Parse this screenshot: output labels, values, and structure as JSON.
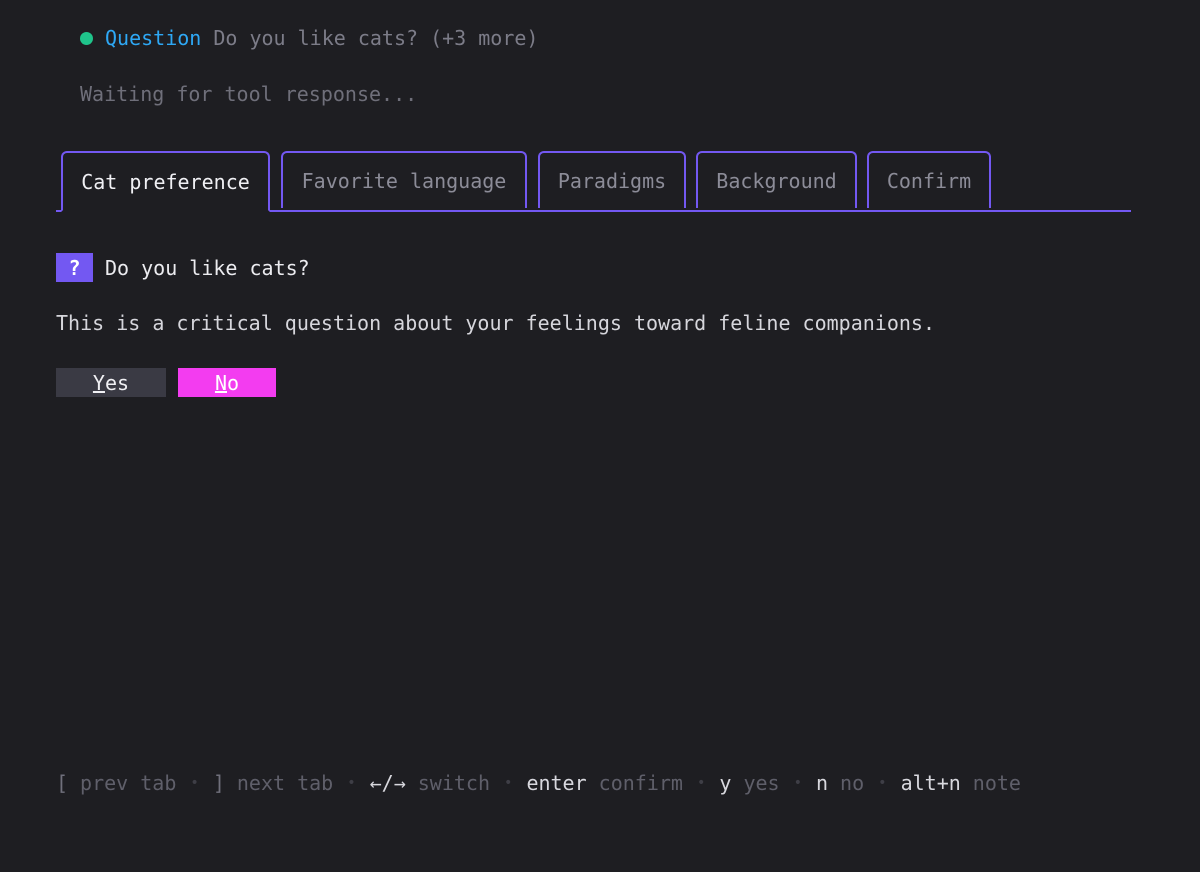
{
  "header": {
    "tool_name": "Question",
    "tool_summary": "Do you like cats? (+3 more)",
    "status_color": "#1fc48b"
  },
  "waiting_text": "Waiting for tool response...",
  "tabs": [
    {
      "label": "Cat preference",
      "active": true
    },
    {
      "label": "Favorite language",
      "active": false
    },
    {
      "label": "Paradigms",
      "active": false
    },
    {
      "label": "Background",
      "active": false
    },
    {
      "label": "Confirm",
      "active": false
    }
  ],
  "question": {
    "badge": "?",
    "text": "Do you like cats?",
    "description": "This is a critical question about your feelings toward feline companions."
  },
  "answers": {
    "yes": {
      "hotkey": "Y",
      "rest": "es",
      "selected": false
    },
    "no": {
      "hotkey": "N",
      "rest": "o",
      "selected": true
    }
  },
  "help": [
    {
      "key": "[",
      "desc": "prev tab"
    },
    {
      "key": "]",
      "desc": "next tab"
    },
    {
      "key": "←/→",
      "desc": "switch"
    },
    {
      "key": "enter",
      "desc": "confirm"
    },
    {
      "key": "y",
      "desc": "yes"
    },
    {
      "key": "n",
      "desc": "no"
    },
    {
      "key": "alt+n",
      "desc": "note"
    }
  ],
  "help_separator": "•",
  "colors": {
    "accent": "#7358f2",
    "tool_name": "#2ea8f5",
    "selected_answer": "#f33cf0",
    "background": "#1e1e22"
  }
}
